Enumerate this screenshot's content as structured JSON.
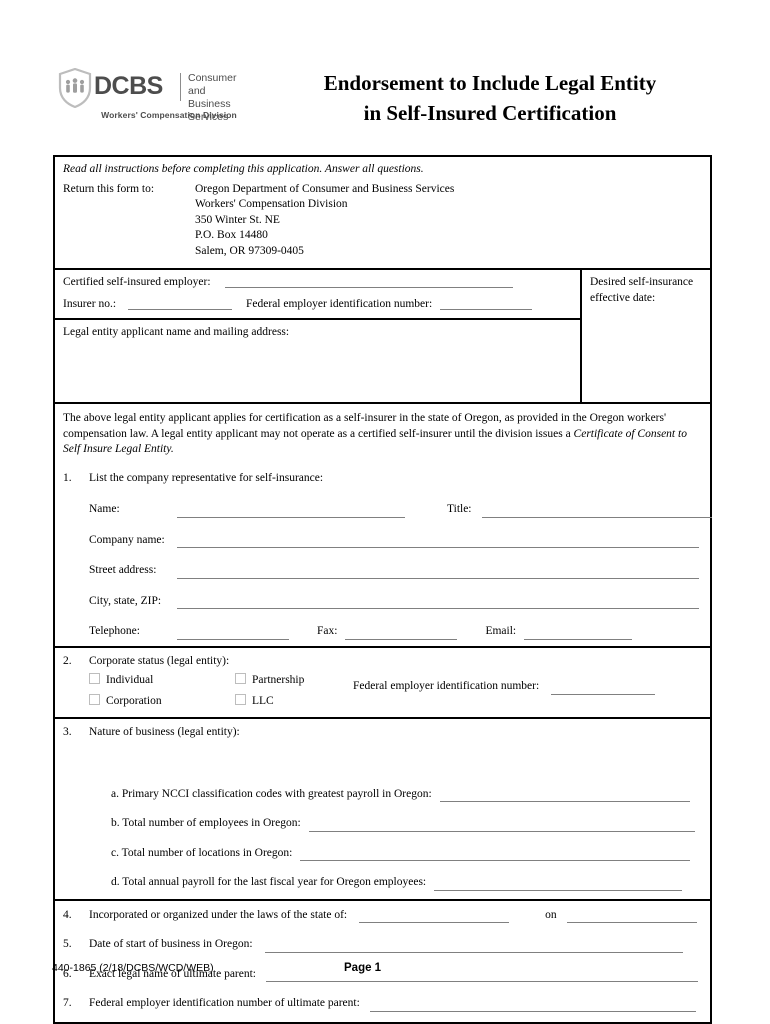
{
  "header": {
    "logo": {
      "wordmark": "DCBS",
      "subtitle_line1": "Consumer and",
      "subtitle_line2": "Business Services",
      "tagline": "Workers' Compensation Division",
      "icon": "shield-people-icon"
    },
    "title_line1": "Endorsement to Include Legal Entity",
    "title_line2": "in Self-Insured Certification"
  },
  "instructions": {
    "read_all": "Read all instructions before completing this application. Answer all questions.",
    "return_label": "Return this form to:",
    "return_address": [
      "Oregon Department of Consumer and Business Services",
      "Workers' Compensation Division",
      "350 Winter St. NE",
      "P.O. Box 14480",
      "Salem, OR 97309-0405"
    ]
  },
  "employer_block": {
    "certified_employer_label": "Certified self-insured employer:",
    "certified_employer_value": "",
    "insurer_no_label": "Insurer no.:",
    "insurer_no_value": "",
    "fein_label": "Federal employer identification number:",
    "fein_value": "",
    "legal_entity_label": "Legal entity applicant name and mailing address:",
    "legal_entity_value": "",
    "desired_date_label_line1": "Desired self-insurance",
    "desired_date_label_line2": "effective date:",
    "desired_date_value": ""
  },
  "statement": {
    "paragraph": "The above legal entity applicant applies for certification as a self-insurer in the state of Oregon, as provided in the Oregon workers' compensation law. A legal entity applicant may not operate as a certified self-insurer until the division issues a ",
    "italic_tail": "Certificate of Consent to Self Insure Legal Entity."
  },
  "item1": {
    "number": "1.",
    "prompt": "List the company representative for self-insurance:",
    "fields": {
      "name_label": "Name:",
      "name_value": "",
      "title_label": "Title:",
      "title_value": "",
      "company_label": "Company name:",
      "company_value": "",
      "street_label": "Street address:",
      "street_value": "",
      "city_label": "City, state, ZIP:",
      "city_value": "",
      "telephone_label": "Telephone:",
      "telephone_value": "",
      "fax_label": "Fax:",
      "fax_value": "",
      "email_label": "Email:",
      "email_value": ""
    }
  },
  "item2": {
    "number": "2.",
    "prompt": "Corporate status (legal entity):",
    "options": [
      {
        "label": "Individual",
        "checked": false
      },
      {
        "label": "Partnership",
        "checked": false
      },
      {
        "label": "Corporation",
        "checked": false
      },
      {
        "label": "LLC",
        "checked": false
      }
    ],
    "fein_label": "Federal employer identification number:",
    "fein_value": ""
  },
  "item3": {
    "number": "3.",
    "prompt": "Nature of business (legal entity):",
    "answer": "",
    "subitems": [
      {
        "label": "a. Primary NCCI classification codes with greatest payroll in Oregon:",
        "value": ""
      },
      {
        "label": "b. Total number of employees in Oregon:",
        "value": ""
      },
      {
        "label": "c. Total number of locations in Oregon:",
        "value": ""
      },
      {
        "label": "d. Total annual payroll for the last fiscal year for Oregon employees:",
        "value": ""
      }
    ]
  },
  "item4": {
    "number": "4.",
    "label": "Incorporated or organized under the laws of the state of:",
    "state_value": "",
    "on_label": "on",
    "on_value": ""
  },
  "item5": {
    "number": "5.",
    "label": "Date of start of business in Oregon:",
    "value": ""
  },
  "item6": {
    "number": "6.",
    "label": "Exact legal name of ultimate parent:",
    "value": ""
  },
  "item7": {
    "number": "7.",
    "label": "Federal employer identification number of ultimate parent:",
    "value": ""
  },
  "footer": {
    "form_code": "440-1865 (2/18/DCBS/WCD/WEB)",
    "page": "Page 1"
  },
  "colors": {
    "ink": "#000000",
    "rule": "#808080",
    "logo_gray": "#4d4d4d",
    "checkbox_border": "#bdbdbd"
  }
}
